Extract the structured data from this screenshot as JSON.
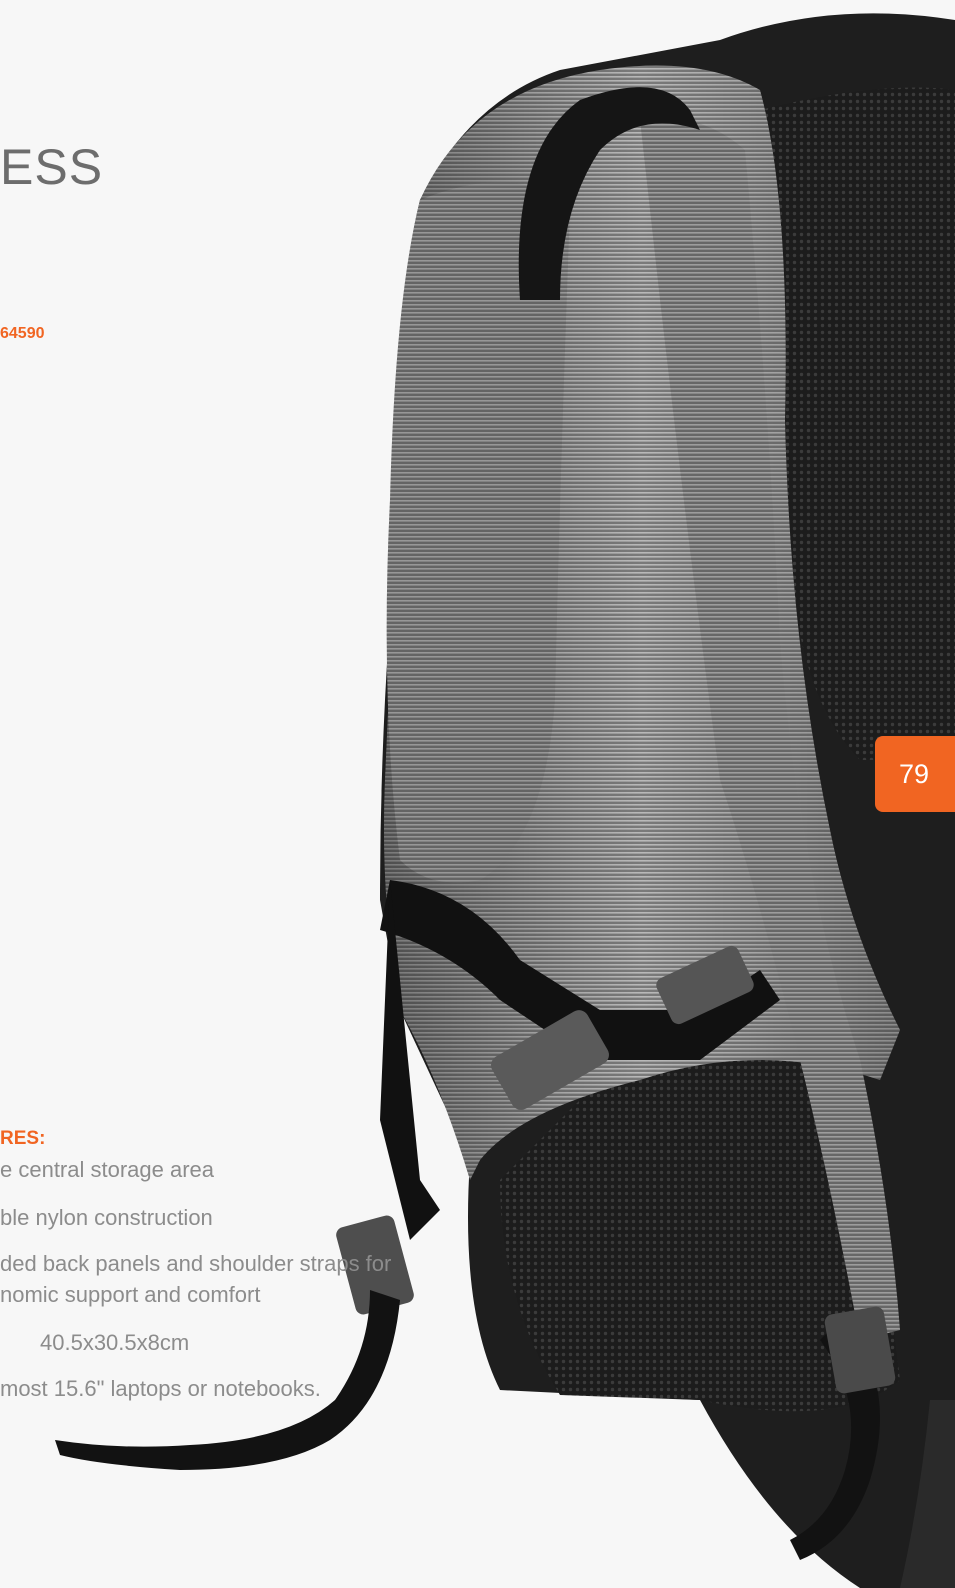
{
  "product": {
    "title_fragment": "ESS",
    "code_fragment": "64590"
  },
  "page_number": "79",
  "features": {
    "heading_fragment": "RES:",
    "items": [
      "e central storage area",
      "ble nylon construction",
      "ded back panels and shoulder straps for",
      "nomic support and comfort",
      "40.5x30.5x8cm",
      "most 15.6\" laptops or notebooks."
    ]
  },
  "colors": {
    "accent": "#f16522",
    "text_grey": "#8c8c8c",
    "background": "#f7f7f7"
  }
}
